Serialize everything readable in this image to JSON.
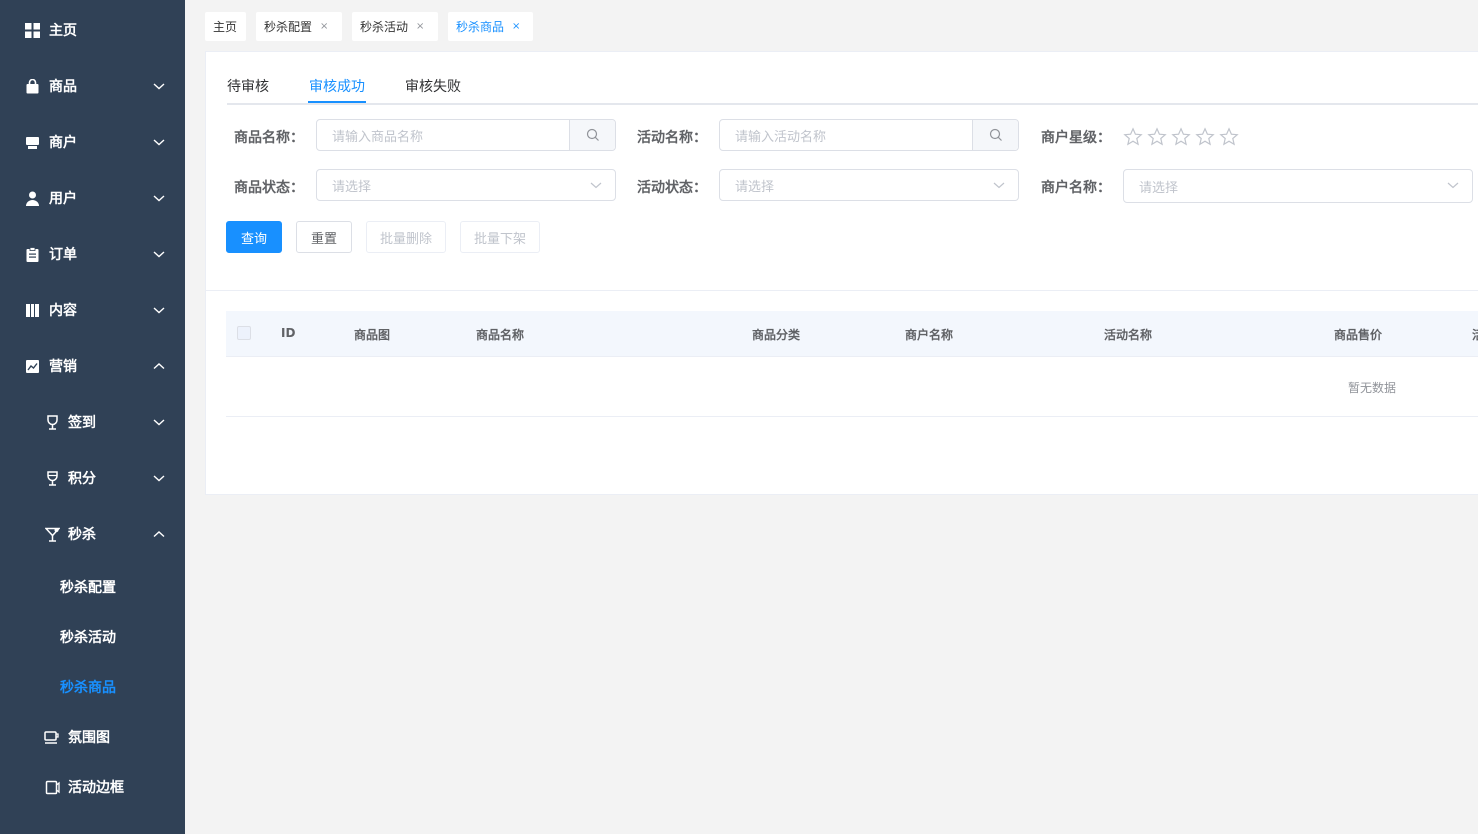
{
  "sidebar": {
    "items": [
      {
        "label": "主页",
        "icon": "dashboard-icon",
        "arrow": ""
      },
      {
        "label": "商品",
        "icon": "shopping-bag-icon",
        "arrow": "down"
      },
      {
        "label": "商户",
        "icon": "store-icon",
        "arrow": "down"
      },
      {
        "label": "用户",
        "icon": "user-icon",
        "arrow": "down"
      },
      {
        "label": "订单",
        "icon": "clipboard-icon",
        "arrow": "down"
      },
      {
        "label": "内容",
        "icon": "book-icon",
        "arrow": "down"
      },
      {
        "label": "营销",
        "icon": "chart-icon",
        "arrow": "up"
      }
    ],
    "sub_items": [
      {
        "label": "签到",
        "icon": "goblet-icon",
        "arrow": "down"
      },
      {
        "label": "积分",
        "icon": "goblet-icon",
        "arrow": "down"
      },
      {
        "label": "秒杀",
        "icon": "cocktail-icon",
        "arrow": "up"
      }
    ],
    "leaf_items": [
      {
        "label": "秒杀配置"
      },
      {
        "label": "秒杀活动"
      },
      {
        "label": "秒杀商品",
        "active": true
      }
    ],
    "extra_items": [
      {
        "label": "氛围图",
        "icon": "cup-icon"
      },
      {
        "label": "活动边框",
        "icon": "frame-icon"
      }
    ]
  },
  "tags": [
    {
      "label": "主页",
      "closable": false
    },
    {
      "label": "秒杀配置",
      "closable": true
    },
    {
      "label": "秒杀活动",
      "closable": true
    },
    {
      "label": "秒杀商品",
      "closable": true,
      "active": true
    }
  ],
  "tabs": [
    {
      "label": "待审核"
    },
    {
      "label": "审核成功",
      "active": true
    },
    {
      "label": "审核失败"
    }
  ],
  "filters": {
    "product_name_label": "商品名称：",
    "product_name_placeholder": "请输入商品名称",
    "activity_name_label": "活动名称：",
    "activity_name_placeholder": "请输入活动名称",
    "merchant_star_label": "商户星级：",
    "product_status_label": "商品状态：",
    "product_status_placeholder": "请选择",
    "activity_status_label": "活动状态：",
    "activity_status_placeholder": "请选择",
    "merchant_name_label": "商户名称：",
    "merchant_name_placeholder": "请选择"
  },
  "buttons": {
    "query": "查询",
    "reset": "重置",
    "batch_delete": "批量删除",
    "batch_offline": "批量下架"
  },
  "table": {
    "columns": [
      "ID",
      "商品图",
      "商品名称",
      "商品分类",
      "商户名称",
      "活动名称",
      "商品售价",
      "活"
    ],
    "empty_text": "暂无数据"
  },
  "colors": {
    "sidebar_bg": "#304156",
    "accent": "#1890ff",
    "page_bg": "#f3f3f3"
  }
}
